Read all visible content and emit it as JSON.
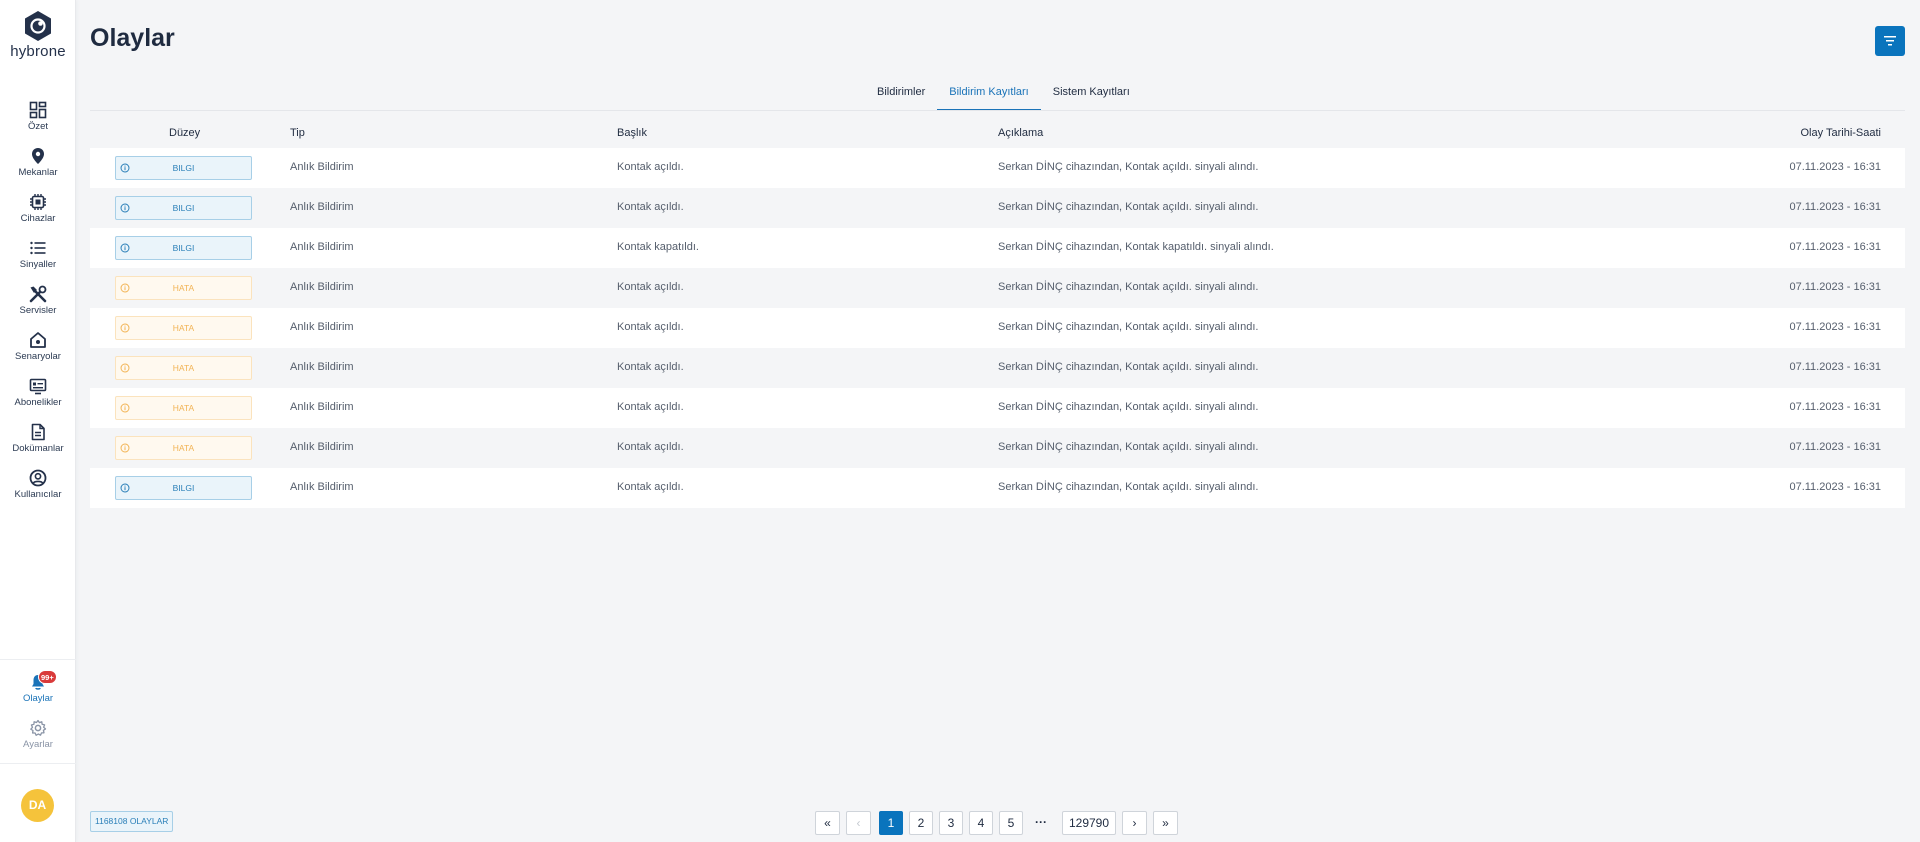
{
  "app": {
    "logo_text": "hybrone"
  },
  "sidebar": {
    "items": [
      {
        "label": "Özet",
        "icon": "dashboard-icon"
      },
      {
        "label": "Mekanlar",
        "icon": "location-pin-icon"
      },
      {
        "label": "Cihazlar",
        "icon": "chip-icon"
      },
      {
        "label": "Sinyaller",
        "icon": "list-icon"
      },
      {
        "label": "Servisler",
        "icon": "tools-icon"
      },
      {
        "label": "Senaryolar",
        "icon": "home-scenario-icon"
      },
      {
        "label": "Abonelikler",
        "icon": "subscription-card-icon"
      },
      {
        "label": "Dokümanlar",
        "icon": "document-icon"
      },
      {
        "label": "Kullanıcılar",
        "icon": "user-circle-icon"
      }
    ],
    "bottom_items": [
      {
        "label": "Olaylar",
        "icon": "bell-icon",
        "badge": "99+",
        "active": true
      },
      {
        "label": "Ayarlar",
        "icon": "gear-icon"
      }
    ],
    "avatar_initials": "DA"
  },
  "header": {
    "title": "Olaylar",
    "filter_icon": "filter-icon"
  },
  "tabs": [
    {
      "label": "Bildirimler",
      "active": false
    },
    {
      "label": "Bildirim Kayıtları",
      "active": true
    },
    {
      "label": "Sistem Kayıtları",
      "active": false
    }
  ],
  "table": {
    "columns": [
      "Düzey",
      "Tip",
      "Başlık",
      "Açıklama",
      "Olay Tarihi-Saati"
    ],
    "rows": [
      {
        "level": "BILGI",
        "level_type": "info",
        "type": "Anlık Bildirim",
        "title": "Kontak açıldı.",
        "description": "Serkan DİNÇ cihazından, Kontak açıldı. sinyali alındı.",
        "datetime": "07.11.2023 - 16:31"
      },
      {
        "level": "BILGI",
        "level_type": "info",
        "type": "Anlık Bildirim",
        "title": "Kontak açıldı.",
        "description": "Serkan DİNÇ cihazından, Kontak açıldı. sinyali alındı.",
        "datetime": "07.11.2023 - 16:31"
      },
      {
        "level": "BILGI",
        "level_type": "info",
        "type": "Anlık Bildirim",
        "title": "Kontak kapatıldı.",
        "description": "Serkan DİNÇ cihazından, Kontak kapatıldı. sinyali alındı.",
        "datetime": "07.11.2023 - 16:31"
      },
      {
        "level": "HATA",
        "level_type": "error",
        "type": "Anlık Bildirim",
        "title": "Kontak açıldı.",
        "description": "Serkan DİNÇ cihazından, Kontak açıldı. sinyali alındı.",
        "datetime": "07.11.2023 - 16:31"
      },
      {
        "level": "HATA",
        "level_type": "error",
        "type": "Anlık Bildirim",
        "title": "Kontak açıldı.",
        "description": "Serkan DİNÇ cihazından, Kontak açıldı. sinyali alındı.",
        "datetime": "07.11.2023 - 16:31"
      },
      {
        "level": "HATA",
        "level_type": "error",
        "type": "Anlık Bildirim",
        "title": "Kontak açıldı.",
        "description": "Serkan DİNÇ cihazından, Kontak açıldı. sinyali alındı.",
        "datetime": "07.11.2023 - 16:31"
      },
      {
        "level": "HATA",
        "level_type": "error",
        "type": "Anlık Bildirim",
        "title": "Kontak açıldı.",
        "description": "Serkan DİNÇ cihazından, Kontak açıldı. sinyali alındı.",
        "datetime": "07.11.2023 - 16:31"
      },
      {
        "level": "HATA",
        "level_type": "error",
        "type": "Anlık Bildirim",
        "title": "Kontak açıldı.",
        "description": "Serkan DİNÇ cihazından, Kontak açıldı. sinyali alındı.",
        "datetime": "07.11.2023 - 16:31"
      },
      {
        "level": "BILGI",
        "level_type": "info",
        "type": "Anlık Bildirim",
        "title": "Kontak açıldı.",
        "description": "Serkan DİNÇ cihazından, Kontak açıldı. sinyali alındı.",
        "datetime": "07.11.2023 - 16:31"
      }
    ]
  },
  "footer": {
    "count_label": "1168108 OLAYLAR",
    "pagination": {
      "first": "«",
      "prev": "‹",
      "pages": [
        "1",
        "2",
        "3",
        "4",
        "5"
      ],
      "ellipsis": "···",
      "last_page": "129790",
      "next": "›",
      "last": "»",
      "current": "1"
    }
  },
  "colors": {
    "accent": "#0a74bd",
    "info": "#2a7fb8",
    "error": "#f2b455",
    "badge": "#d93a3a",
    "avatar": "#f5c33b"
  }
}
